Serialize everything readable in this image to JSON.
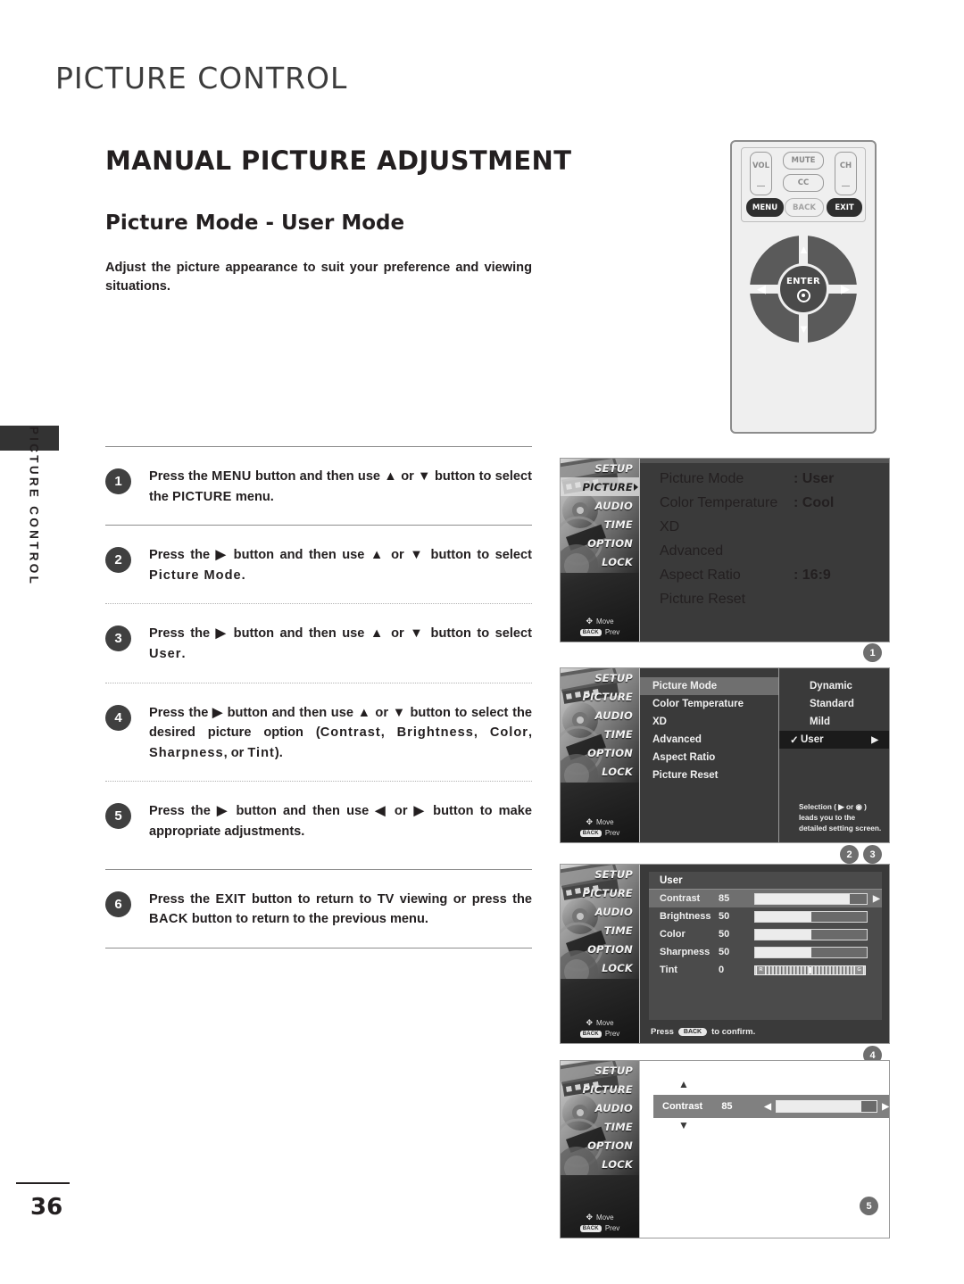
{
  "page": {
    "chapter_title": "PICTURE CONTROL",
    "section_title": "MANUAL PICTURE ADJUSTMENT",
    "sub_title": "Picture Mode - User Mode",
    "intro": "Adjust the picture appearance to suit your preference and viewing situations.",
    "side_tab": "PICTURE CONTROL",
    "page_number": "36"
  },
  "remote": {
    "vol_label": "VOL",
    "ch_label": "CH",
    "mute_label": "MUTE",
    "cc_label": "CC",
    "menu_label": "MENU",
    "back_label": "BACK",
    "exit_label": "EXIT",
    "enter_label": "ENTER",
    "arrow_up": "▲",
    "arrow_down": "▼",
    "arrow_left": "◀",
    "arrow_right": "▶"
  },
  "steps": [
    {
      "number": "1",
      "html": "Press the <b>MENU</b> button and then use ▲ or ▼ button to select the <b>PICTURE</b> menu."
    },
    {
      "number": "2",
      "html": "Press the ▶ button and then use ▲ or ▼ button to select <b class=\"mono\">Picture Mode</b>."
    },
    {
      "number": "3",
      "html": "Press the ▶ button and then use ▲ or ▼ button to select <b class=\"mono\">User</b>."
    },
    {
      "number": "4",
      "html": "Press the ▶ button and then use ▲ or ▼ button to select the desired picture option (<b class=\"mono\">Contrast</b>, <b class=\"mono\">Brightness</b>, <b class=\"mono\">Color</b>, <b class=\"mono\">Sharpness</b>, or <b class=\"mono\">Tint</b>)."
    },
    {
      "number": "5",
      "html": "Press the ▶ button and then use ◀ or ▶ button to make appropriate adjustments."
    },
    {
      "number": "6",
      "html": "Press the <b>EXIT</b> button to return to TV viewing or press the <b>BACK</b> button to return to the previous menu."
    }
  ],
  "osd_common": {
    "sidebar_items": [
      "SETUP",
      "PICTURE",
      "AUDIO",
      "TIME",
      "OPTION",
      "LOCK"
    ],
    "active_item": "PICTURE",
    "hint_move": "Move",
    "hint_prev": "Prev",
    "hint_prev_badge": "BACK"
  },
  "osd1": {
    "rows": [
      {
        "label": "Picture Mode",
        "value": ": User"
      },
      {
        "label": "Color Temperature",
        "value": ": Cool"
      },
      {
        "label": "XD",
        "value": ""
      },
      {
        "label": "Advanced",
        "value": ""
      },
      {
        "label": "Aspect Ratio",
        "value": ": 16:9"
      },
      {
        "label": "Picture Reset",
        "value": ""
      }
    ]
  },
  "osd2": {
    "menu_items": [
      "Picture Mode",
      "Color Temperature",
      "XD",
      "Advanced",
      "Aspect Ratio",
      "Picture Reset"
    ],
    "selected_menu_item": "Picture Mode",
    "options": [
      "Dynamic",
      "Standard",
      "Mild",
      "User"
    ],
    "selected_option": "User",
    "check_mark": "✓",
    "option_arrow": "▶",
    "note": "Selection ( ▶ or ◉ ) leads you to the detailed setting screen."
  },
  "osd3": {
    "header": "User",
    "sliders": [
      {
        "name": "Contrast",
        "value": "85",
        "percent": 85,
        "selected": true
      },
      {
        "name": "Brightness",
        "value": "50",
        "percent": 50,
        "selected": false
      },
      {
        "name": "Color",
        "value": "50",
        "percent": 50,
        "selected": false
      },
      {
        "name": "Sharpness",
        "value": "50",
        "percent": 50,
        "selected": false
      }
    ],
    "tint": {
      "name": "Tint",
      "value": "0",
      "left_cap": "R",
      "right_cap": "G"
    },
    "row_arrow": "▶",
    "footer_prefix": "Press",
    "footer_badge": "BACK",
    "footer_suffix": "to confirm."
  },
  "osd4": {
    "name": "Contrast",
    "value": "85",
    "percent": 85,
    "arrow_left": "◀",
    "arrow_right": "▶",
    "arrow_up": "▲",
    "arrow_down": "▼"
  },
  "markers": {
    "m1": "1",
    "m2": "2",
    "m3": "3",
    "m4": "4",
    "m5": "5"
  }
}
